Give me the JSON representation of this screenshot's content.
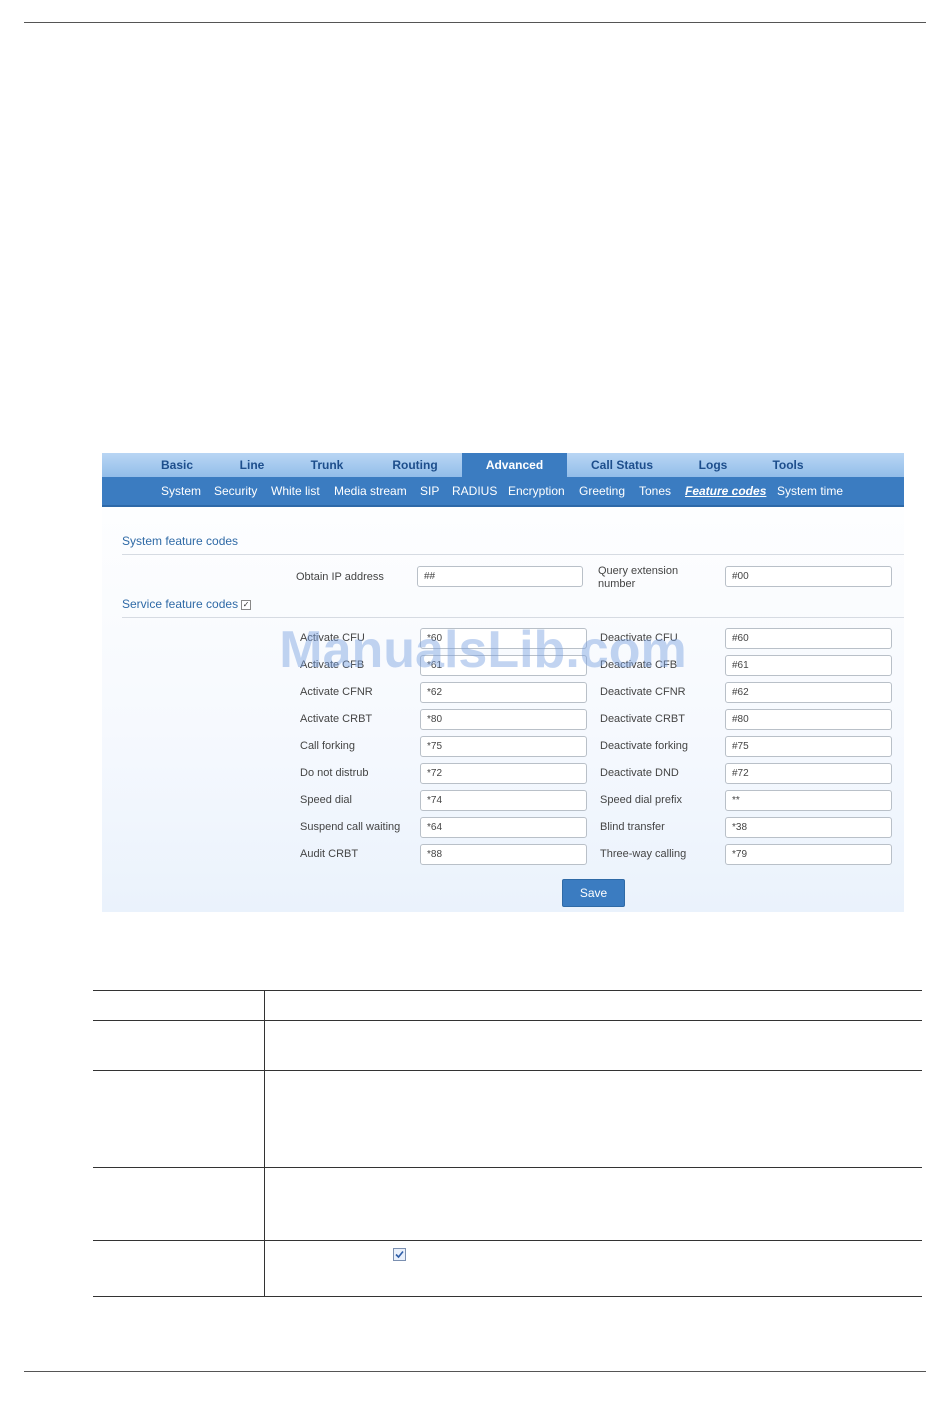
{
  "top_nav": [
    "Basic",
    "Line",
    "Trunk",
    "Routing",
    "Advanced",
    "Call Status",
    "Logs",
    "Tools"
  ],
  "active_top_tab": "Advanced",
  "sub_nav": [
    "System",
    "Security",
    "White list",
    "Media stream",
    "SIP",
    "RADIUS",
    "Encryption",
    "Greeting",
    "Tones",
    "Feature codes",
    "System time"
  ],
  "active_sub_tab": "Feature codes",
  "system_section": {
    "title": "System feature codes",
    "obtain_ip_label": "Obtain IP address",
    "obtain_ip_value": "##",
    "query_ext_label_1": "Query extension",
    "query_ext_label_2": "number",
    "query_ext_value": "#00"
  },
  "service_section": {
    "title": "Service feature codes",
    "checked": true
  },
  "service_rows": [
    {
      "left_label": "Activate CFU",
      "left_value": "*60",
      "right_label": "Deactivate CFU",
      "right_value": "#60"
    },
    {
      "left_label": "Activate CFB",
      "left_value": "*61",
      "right_label": "Deactivate CFB",
      "right_value": "#61"
    },
    {
      "left_label": "Activate CFNR",
      "left_value": "*62",
      "right_label": "Deactivate CFNR",
      "right_value": "#62"
    },
    {
      "left_label": "Activate CRBT",
      "left_value": "*80",
      "right_label": "Deactivate CRBT",
      "right_value": "#80"
    },
    {
      "left_label": "Call forking",
      "left_value": "*75",
      "right_label": "Deactivate forking",
      "right_value": "#75"
    },
    {
      "left_label": "Do not distrub",
      "left_value": "*72",
      "right_label": "Deactivate DND",
      "right_value": "#72"
    },
    {
      "left_label": "Speed dial",
      "left_value": "*74",
      "right_label": "Speed dial prefix",
      "right_value": "**"
    },
    {
      "left_label": "Suspend call waiting",
      "left_value": "*64",
      "right_label": "Blind transfer",
      "right_value": "*38"
    },
    {
      "left_label": "Audit CRBT",
      "left_value": "*88",
      "right_label": "Three-way calling",
      "right_value": "*79"
    }
  ],
  "save_label": "Save",
  "watermark": "ManualsLib.com",
  "colors": {
    "nav_active": "#3b7cc1",
    "nav_text": "#1d4e8c",
    "section_title": "#2f6aa6"
  }
}
